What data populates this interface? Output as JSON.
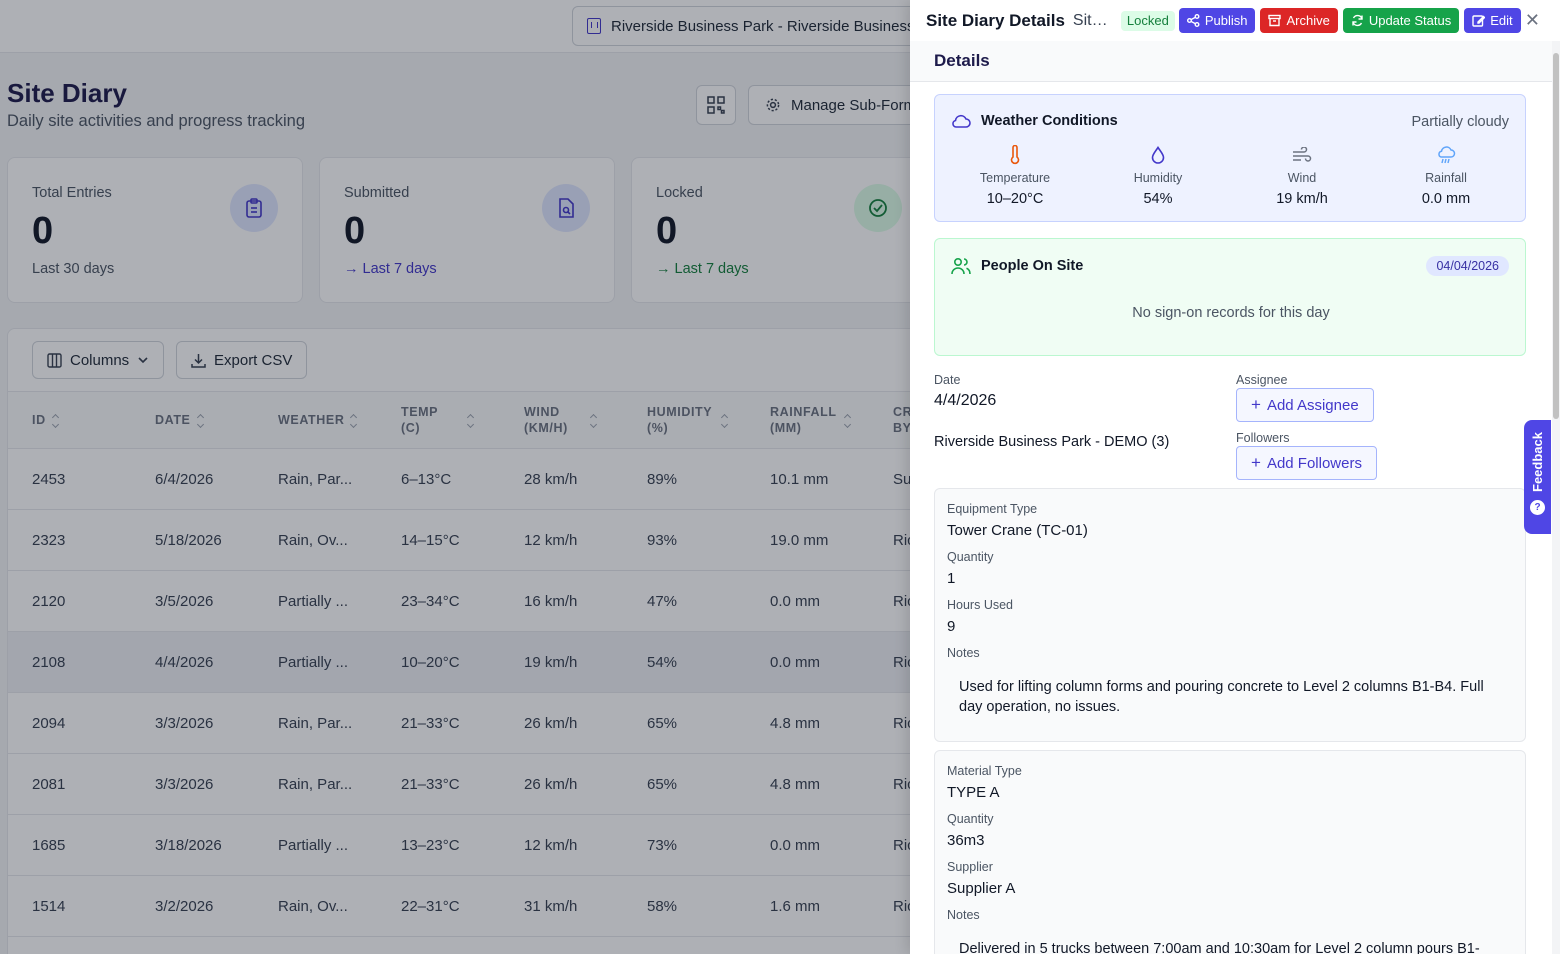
{
  "header": {
    "project_selector": "Riverside Business Park - Riverside Business"
  },
  "page": {
    "title": "Site Diary",
    "subtitle": "Daily site activities and progress tracking",
    "manage_subforms_label": "Manage Sub-Forms"
  },
  "stats": [
    {
      "label": "Total Entries",
      "value": "0",
      "foot": "Last 30 days"
    },
    {
      "label": "Submitted",
      "value": "0",
      "foot": "→ Last 7 days"
    },
    {
      "label": "Locked",
      "value": "0",
      "foot": "→ Last 7 days"
    }
  ],
  "table": {
    "columns_label": "Columns",
    "export_label": "Export CSV",
    "headers": [
      "ID",
      "DATE",
      "WEATHER",
      "TEMP (C)",
      "WIND (KM/H)",
      "HUMIDITY (%)",
      "RAINFALL (MM)",
      "CREATED BY"
    ],
    "rows": [
      {
        "id": "2453",
        "date": "6/4/2026",
        "weather": "Rain, Par...",
        "temp": "6–13°C",
        "wind": "28 km/h",
        "humidity": "89%",
        "rainfall": "10.1 mm",
        "created_by": "Su"
      },
      {
        "id": "2323",
        "date": "5/18/2026",
        "weather": "Rain, Ov...",
        "temp": "14–15°C",
        "wind": "12 km/h",
        "humidity": "93%",
        "rainfall": "19.0 mm",
        "created_by": "Ric"
      },
      {
        "id": "2120",
        "date": "3/5/2026",
        "weather": "Partially ...",
        "temp": "23–34°C",
        "wind": "16 km/h",
        "humidity": "47%",
        "rainfall": "0.0 mm",
        "created_by": "Ric"
      },
      {
        "id": "2108",
        "date": "4/4/2026",
        "weather": "Partially ...",
        "temp": "10–20°C",
        "wind": "19 km/h",
        "humidity": "54%",
        "rainfall": "0.0 mm",
        "created_by": "Ric"
      },
      {
        "id": "2094",
        "date": "3/3/2026",
        "weather": "Rain, Par...",
        "temp": "21–33°C",
        "wind": "26 km/h",
        "humidity": "65%",
        "rainfall": "4.8 mm",
        "created_by": "Ric"
      },
      {
        "id": "2081",
        "date": "3/3/2026",
        "weather": "Rain, Par...",
        "temp": "21–33°C",
        "wind": "26 km/h",
        "humidity": "65%",
        "rainfall": "4.8 mm",
        "created_by": "Ric"
      },
      {
        "id": "1685",
        "date": "3/18/2026",
        "weather": "Partially ...",
        "temp": "13–23°C",
        "wind": "12 km/h",
        "humidity": "73%",
        "rainfall": "0.0 mm",
        "created_by": "Ric"
      },
      {
        "id": "1514",
        "date": "3/2/2026",
        "weather": "Rain, Ov...",
        "temp": "22–31°C",
        "wind": "31 km/h",
        "humidity": "58%",
        "rainfall": "1.6 mm",
        "created_by": "Ric"
      }
    ]
  },
  "drawer": {
    "title": "Site Diary Details",
    "subtitle": "Site Diary",
    "status": "Locked",
    "actions": {
      "publish": "Publish",
      "archive": "Archive",
      "update_status": "Update Status",
      "edit": "Edit"
    },
    "close_glyph": "✕",
    "section_title": "Details",
    "weather": {
      "title": "Weather Conditions",
      "condition": "Partially cloudy",
      "items": [
        {
          "label": "Temperature",
          "value": "10–20°C",
          "icon": "thermometer-icon"
        },
        {
          "label": "Humidity",
          "value": "54%",
          "icon": "droplet-icon"
        },
        {
          "label": "Wind",
          "value": "19 km/h",
          "icon": "wind-icon"
        },
        {
          "label": "Rainfall",
          "value": "0.0 mm",
          "icon": "cloud-rain-icon"
        }
      ]
    },
    "people": {
      "title": "People On Site",
      "date": "04/04/2026",
      "empty": "No sign-on records for this day"
    },
    "fields": {
      "date_label": "Date",
      "date_value": "4/4/2026",
      "project_value": "Riverside Business Park - DEMO (3)",
      "assignee_label": "Assignee",
      "add_assignee": "Add Assignee",
      "followers_label": "Followers",
      "add_followers": "Add Followers"
    },
    "equipment": {
      "type_label": "Equipment Type",
      "type_value": "Tower Crane (TC-01)",
      "quantity_label": "Quantity",
      "quantity_value": "1",
      "hours_label": "Hours Used",
      "hours_value": "9",
      "notes_label": "Notes",
      "notes_value": "Used for lifting column forms and pouring concrete to Level 2 columns B1-B4. Full day operation, no issues."
    },
    "material": {
      "type_label": "Material Type",
      "type_value": "TYPE A",
      "quantity_label": "Quantity",
      "quantity_value": "36m3",
      "supplier_label": "Supplier",
      "supplier_value": "Supplier A",
      "notes_label": "Notes",
      "notes_value": "Delivered in 5 trucks between 7:00am and 10:30am for Level 2 column pours B1-"
    }
  },
  "feedback_label": "Feedback",
  "feedback_glyph": "?"
}
